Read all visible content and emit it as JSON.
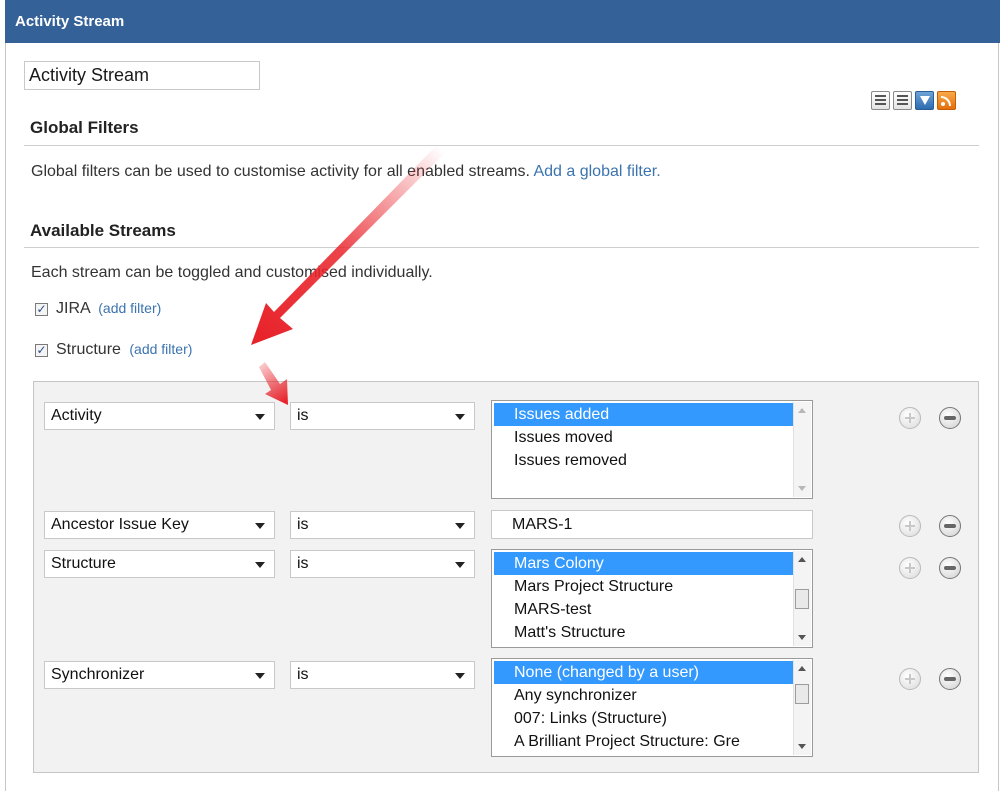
{
  "header": {
    "title": "Activity Stream"
  },
  "gadget_title_value": "Activity Stream",
  "toolbar": {
    "icons": [
      "list-compact-icon",
      "list-full-icon",
      "filter-icon",
      "rss-icon"
    ]
  },
  "global_filters": {
    "heading": "Global Filters",
    "description": "Global filters can be used to customise activity for all enabled streams.",
    "link": "Add a global filter."
  },
  "available_streams": {
    "heading": "Available Streams",
    "description": "Each stream can be toggled and customised individually.",
    "streams": [
      {
        "label": "JIRA",
        "checked": true,
        "link": "(add filter)"
      },
      {
        "label": "Structure",
        "checked": true,
        "link": "(add filter)"
      }
    ]
  },
  "filters": [
    {
      "field": "Activity",
      "operator": "is",
      "options": [
        "Issues added",
        "Issues moved",
        "Issues removed"
      ],
      "selected": "Issues added"
    },
    {
      "field": "Ancestor Issue Key",
      "operator": "is",
      "value": "MARS-1"
    },
    {
      "field": "Structure",
      "operator": "is",
      "options": [
        "Mars Colony",
        "Mars Project Structure",
        "MARS-test",
        "Matt's Structure"
      ],
      "selected": "Mars Colony"
    },
    {
      "field": "Synchronizer",
      "operator": "is",
      "options": [
        "None (changed by a user)",
        "Any synchronizer",
        "007: Links (Structure)",
        "A Brilliant Project Structure: Gre"
      ],
      "selected": "None (changed by a user)"
    }
  ],
  "colors": {
    "header_bg": "#356199",
    "link": "#3b73af",
    "selection": "#3399ff",
    "annotation_arrow": "#e8232a"
  }
}
